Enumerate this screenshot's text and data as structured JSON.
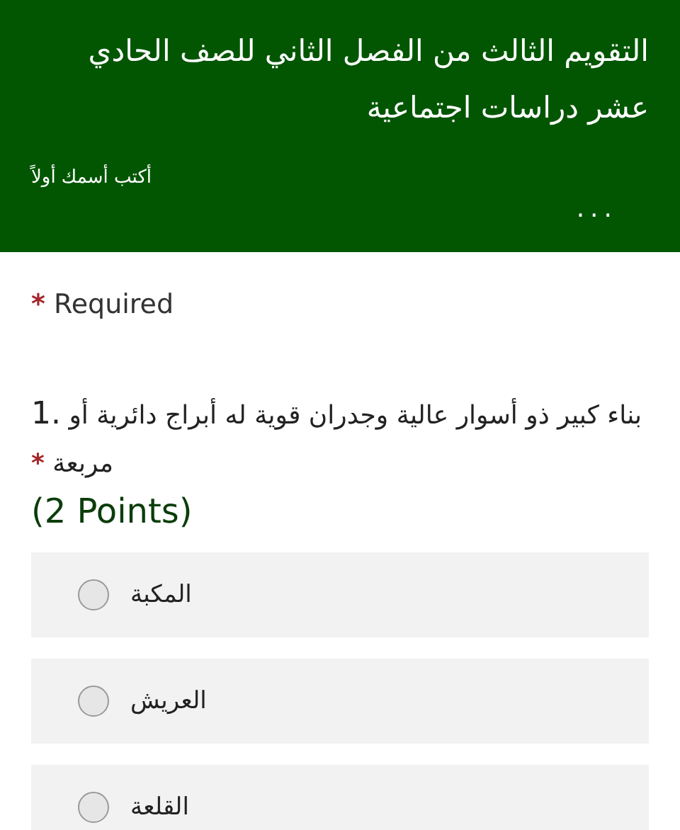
{
  "header": {
    "title": "التقويم الثالث من الفصل الثاني للصف الحادي عشر دراسات اجتماعية",
    "subtitle": "أكتب أسمك أولاً",
    "more": "..."
  },
  "required_note": {
    "mark": "*",
    "label": "Required"
  },
  "questions": [
    {
      "number": "1.",
      "text": "بناء كبير ذو أسوار عالية وجدران قوية له أبراج دائرية أو مربعة",
      "required": true,
      "points": "(2 Points)",
      "options": [
        {
          "label": "المكبة",
          "selected": false
        },
        {
          "label": "العريش",
          "selected": false
        },
        {
          "label": "القلعة",
          "selected": false
        }
      ]
    }
  ]
}
